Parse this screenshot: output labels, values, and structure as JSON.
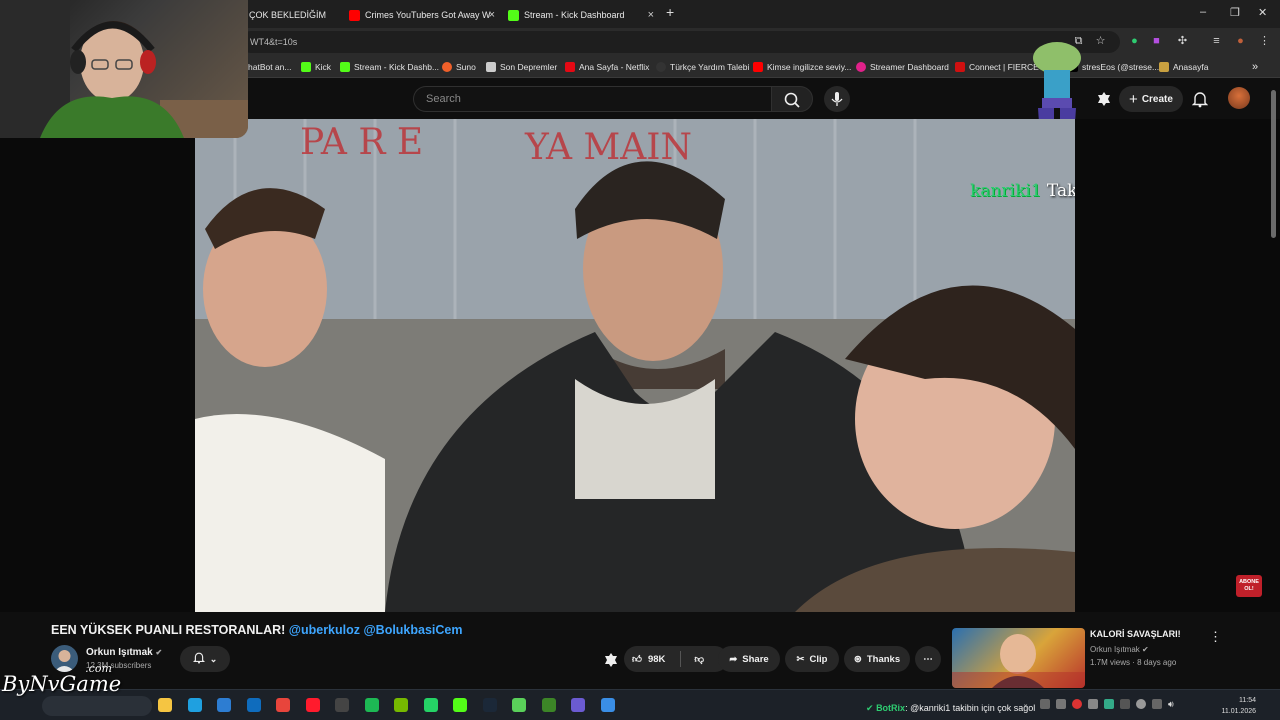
{
  "tabs": [
    {
      "label": "N ÇOK BEKLEDİĞİM",
      "favicon_color": "#888888"
    },
    {
      "label": "Crimes YouTubers Got Away W",
      "favicon_color": "#ff0000"
    },
    {
      "label": "Stream - Kick Dashboard",
      "favicon_color": "#53fc18"
    }
  ],
  "address": {
    "url": "WT4&t=10s"
  },
  "bookmarks": [
    {
      "label": "hatBot an...",
      "color": "#888888"
    },
    {
      "label": "Kick",
      "color": "#53fc18"
    },
    {
      "label": "Stream - Kick Dashb...",
      "color": "#53fc18"
    },
    {
      "label": "Suno",
      "color": "#f0602a"
    },
    {
      "label": "Son Depremler",
      "color": "#cccccc"
    },
    {
      "label": "Ana Sayfa - Netflix",
      "color": "#e50914"
    },
    {
      "label": "Türkçe Yardım Talebi",
      "color": "#333333"
    },
    {
      "label": "Kimse ingilizce seviy...",
      "color": "#ff0000"
    },
    {
      "label": "Streamer Dashboard",
      "color": "#e0218a"
    },
    {
      "label": "Connect | FIERCE G",
      "color": "#d01010"
    },
    {
      "label": "stresEos (@strese...",
      "color": "#000000"
    },
    {
      "label": "Anasayfa",
      "color": "#c8a040"
    }
  ],
  "header": {
    "search_placeholder": "Search",
    "create_label": "Create"
  },
  "overlay": {
    "follow_user": "kanriki1",
    "follow_text": "Takip etti",
    "corner_badge": "ABONE OL!"
  },
  "video": {
    "title_main": "EEN YÜKSEK PUANLI RESTORANLAR!",
    "title_tags": "@uberkuloz @BolukbasiCem",
    "channel": "Orkun Işıtmak",
    "subscribers": "12.3M subscribers",
    "likes": "98K",
    "share_label": "Share",
    "clip_label": "Clip",
    "thanks_label": "Thanks"
  },
  "recommendation": {
    "title": "KALORİ SAVAŞLARI!",
    "channel": "Orkun Işıtmak",
    "meta": "1.7M views · 8 days ago"
  },
  "stream": {
    "watermark": "ByNvGame",
    "watermark_suffix": ".com",
    "bot_name": "BotRix",
    "bot_message": ": @kanriki1 takibin için çok sağol"
  },
  "taskbar": {
    "time": "11:54",
    "date": "11.01.2026",
    "icons": [
      {
        "name": "explorer",
        "color": "#f5c542"
      },
      {
        "name": "edge",
        "color": "#1fa0e0"
      },
      {
        "name": "store",
        "color": "#2d7dd2"
      },
      {
        "name": "outlook",
        "color": "#0f6cbd"
      },
      {
        "name": "chrome",
        "color": "#e8453c"
      },
      {
        "name": "opera",
        "color": "#ff1b2d"
      },
      {
        "name": "obs",
        "color": "#444444"
      },
      {
        "name": "spotify",
        "color": "#1db954"
      },
      {
        "name": "nvidia",
        "color": "#76b900"
      },
      {
        "name": "whatsapp",
        "color": "#25d366"
      },
      {
        "name": "kick",
        "color": "#53fc18"
      },
      {
        "name": "steam",
        "color": "#1b2838"
      },
      {
        "name": "discord-like",
        "color": "#5ad05a"
      },
      {
        "name": "minecraft",
        "color": "#3c8527"
      },
      {
        "name": "app",
        "color": "#6b5bd2"
      },
      {
        "name": "notes",
        "color": "#3a8ee6"
      }
    ]
  }
}
